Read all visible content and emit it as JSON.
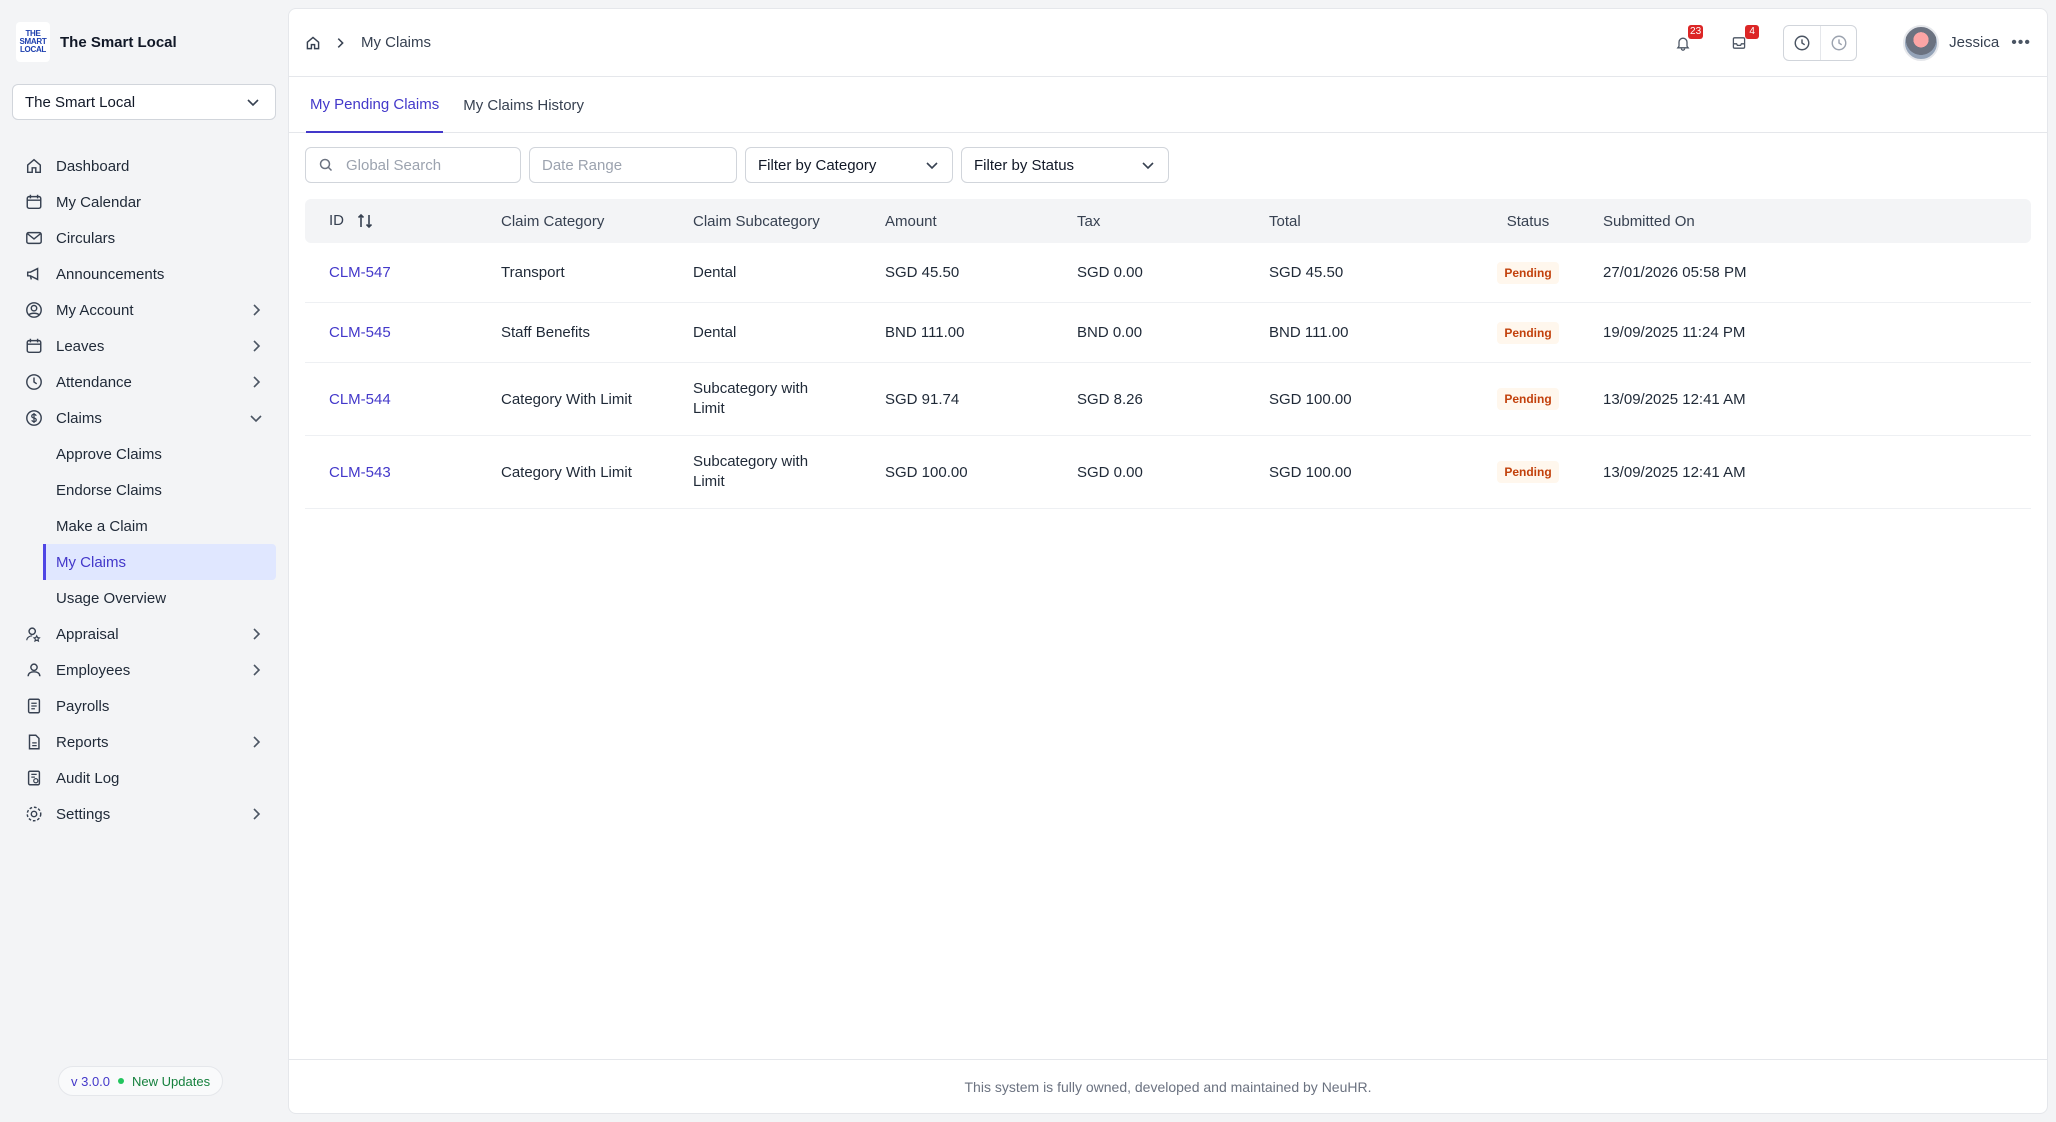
{
  "brand": {
    "logo_lines": [
      "THE",
      "SMART",
      "LOCAL"
    ],
    "name": "The Smart Local"
  },
  "org_select": {
    "value": "The Smart Local"
  },
  "sidebar": {
    "items": [
      {
        "label": "Dashboard",
        "icon": "home-icon"
      },
      {
        "label": "My Calendar",
        "icon": "calendar-icon"
      },
      {
        "label": "Circulars",
        "icon": "mail-icon"
      },
      {
        "label": "Announcements",
        "icon": "megaphone-icon"
      },
      {
        "label": "My Account",
        "icon": "user-circle-icon"
      },
      {
        "label": "Leaves",
        "icon": "calendar-leave-icon"
      },
      {
        "label": "Attendance",
        "icon": "clock-icon"
      },
      {
        "label": "Claims",
        "icon": "dollar-icon"
      },
      {
        "label": "Appraisal",
        "icon": "user-star-icon"
      },
      {
        "label": "Employees",
        "icon": "user-icon"
      },
      {
        "label": "Payrolls",
        "icon": "receipt-icon"
      },
      {
        "label": "Reports",
        "icon": "file-icon"
      },
      {
        "label": "Audit Log",
        "icon": "log-icon"
      },
      {
        "label": "Settings",
        "icon": "gear-icon"
      }
    ],
    "claims_sub": [
      "Approve Claims",
      "Endorse Claims",
      "Make a Claim",
      "My Claims",
      "Usage Overview"
    ]
  },
  "version": {
    "label": "v 3.0.0",
    "updates": "New Updates"
  },
  "breadcrumb": {
    "current": "My Claims"
  },
  "topbar": {
    "notifications_count": "23",
    "inbox_count": "4",
    "user_name": "Jessica"
  },
  "tabs": [
    "My Pending Claims",
    "My Claims History"
  ],
  "filters": {
    "search_placeholder": "Global Search",
    "date_placeholder": "Date Range",
    "category": "Filter by Category",
    "status": "Filter by Status"
  },
  "table": {
    "headers": [
      "ID",
      "Claim Category",
      "Claim Subcategory",
      "Amount",
      "Tax",
      "Total",
      "Status",
      "Submitted On"
    ],
    "rows": [
      {
        "id": "CLM-547",
        "category": "Transport",
        "subcategory": "Dental",
        "amount": "SGD 45.50",
        "tax": "SGD 0.00",
        "total": "SGD 45.50",
        "status": "Pending",
        "submitted": "27/01/2026 05:58 PM"
      },
      {
        "id": "CLM-545",
        "category": "Staff Benefits",
        "subcategory": "Dental",
        "amount": "BND 111.00",
        "tax": "BND 0.00",
        "total": "BND 111.00",
        "status": "Pending",
        "submitted": "19/09/2025 11:24 PM"
      },
      {
        "id": "CLM-544",
        "category": "Category With Limit",
        "subcategory": "Subcategory with Limit",
        "amount": "SGD 91.74",
        "tax": "SGD 8.26",
        "total": "SGD 100.00",
        "status": "Pending",
        "submitted": "13/09/2025 12:41 AM"
      },
      {
        "id": "CLM-543",
        "category": "Category With Limit",
        "subcategory": "Subcategory with Limit",
        "amount": "SGD 100.00",
        "tax": "SGD 0.00",
        "total": "SGD 100.00",
        "status": "Pending",
        "submitted": "13/09/2025 12:41 AM"
      }
    ]
  },
  "footer": {
    "text": "This system is fully owned, developed and maintained by NeuHR."
  }
}
